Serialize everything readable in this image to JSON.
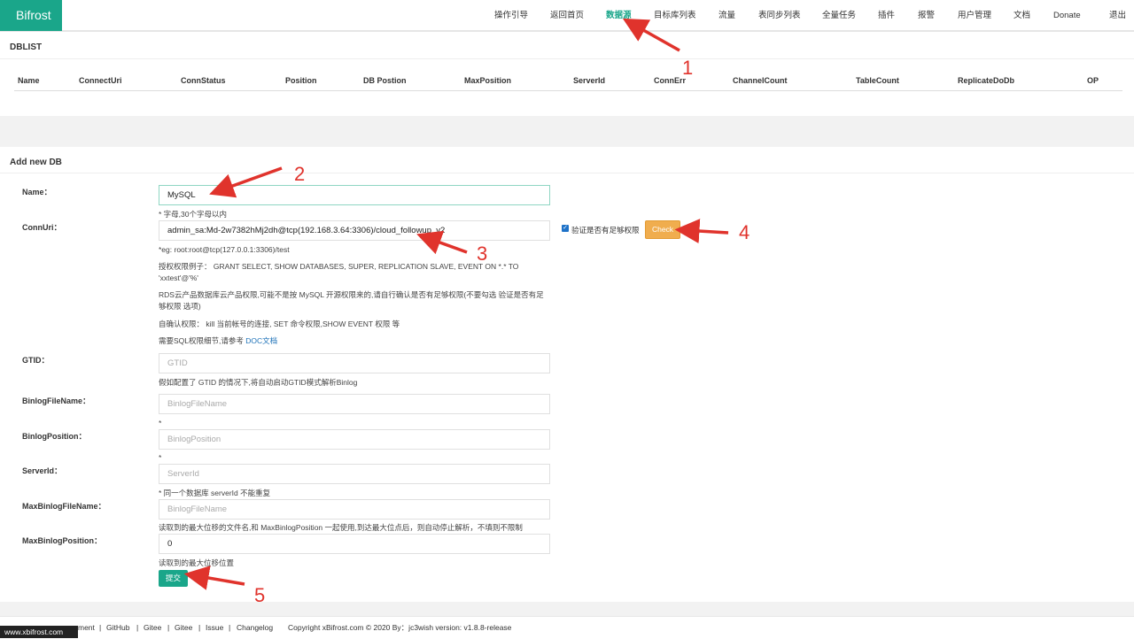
{
  "brand": "Bifrost",
  "nav": [
    {
      "label": "操作引导",
      "active": false
    },
    {
      "label": "返回首页",
      "active": false
    },
    {
      "label": "数据源",
      "active": true
    },
    {
      "label": "目标库列表",
      "active": false
    },
    {
      "label": "流量",
      "active": false
    },
    {
      "label": "表同步列表",
      "active": false
    },
    {
      "label": "全量任务",
      "active": false
    },
    {
      "label": "插件",
      "active": false
    },
    {
      "label": "报警",
      "active": false
    },
    {
      "label": "用户管理",
      "active": false
    },
    {
      "label": "文档",
      "active": false
    },
    {
      "label": "Donate",
      "active": false
    },
    {
      "label": "退出",
      "active": false
    }
  ],
  "dblist": {
    "title": "DBLIST",
    "columns": [
      "Name",
      "ConnectUri",
      "ConnStatus",
      "Position",
      "DB Postion",
      "MaxPosition",
      "ServerId",
      "ConnErr",
      "ChannelCount",
      "TableCount",
      "ReplicateDoDb",
      "OP"
    ]
  },
  "form": {
    "title": "Add new DB",
    "name": {
      "label": "Name：",
      "value": "MySQL",
      "hint": "* 字母,30个字母以内"
    },
    "connuri": {
      "label": "ConnUri：",
      "value": "admin_sa:Md-2w7382hMj2dh@tcp(192.168.3.64:3306)/cloud_followup_v2",
      "check_label": "验证是否有足够权限",
      "check_button": "Check",
      "hint_eg": "*eg: root:root@tcp(127.0.0.1:3306)/test",
      "hint_grant": "授权权限例子：  GRANT SELECT, SHOW DATABASES, SUPER, REPLICATION SLAVE, EVENT ON *.* TO 'xxtest'@'%'",
      "hint_rds": "RDS云产品数据库云产品权限,可能不是按 MySQL 开源权限来的,请自行确认是否有足够权限(不要勾选 验证是否有足够权限 选项)",
      "hint_self": "自确认权限：  kill 当前帐号的连接, SET 命令权限,SHOW EVENT 权限 等",
      "hint_doc_prefix": "需要SQL权限细节,请参考 ",
      "hint_doc_link": "DOC文档"
    },
    "gtid": {
      "label": "GTID：",
      "placeholder": "GTID",
      "hint": "假如配置了 GTID 的情况下,将自动启动GTID模式解析Binlog"
    },
    "binlog_file": {
      "label": "BinlogFileName：",
      "placeholder": "BinlogFileName",
      "hint": "*"
    },
    "binlog_pos": {
      "label": "BinlogPosition：",
      "placeholder": "BinlogPosition",
      "hint": "*"
    },
    "server_id": {
      "label": "ServerId：",
      "placeholder": "ServerId",
      "hint": "* 同一个数据库 serverId 不能重复"
    },
    "max_binlog_file": {
      "label": "MaxBinlogFileName：",
      "placeholder": "BinlogFileName",
      "hint": "读取到的最大位移的文件名,和 MaxBinlogPosition 一起使用,到达最大位点后，则自动停止解析，不填则不限制"
    },
    "max_binlog_pos": {
      "label": "MaxBinlogPosition：",
      "value": "0",
      "hint": "读取到的最大位移位置"
    },
    "submit": "提交"
  },
  "footer": {
    "links": [
      "ment",
      "|",
      "GitHub",
      "|",
      "Gitee",
      "|",
      "Gitee",
      "|",
      "Issue",
      "|",
      "Changelog"
    ],
    "copyright": "Copyright  xBifrost.com  © 2020  By：jc3wish  version:  v1.8.8-release"
  },
  "watermark": "www.xbifrost.com",
  "annotations": {
    "color": "#e0332c",
    "numbers": [
      "1",
      "2",
      "3",
      "4",
      "5"
    ]
  },
  "colors": {
    "brand": "#1aa68a",
    "check_button": "#f0ad4e",
    "link": "#1e72b8"
  }
}
